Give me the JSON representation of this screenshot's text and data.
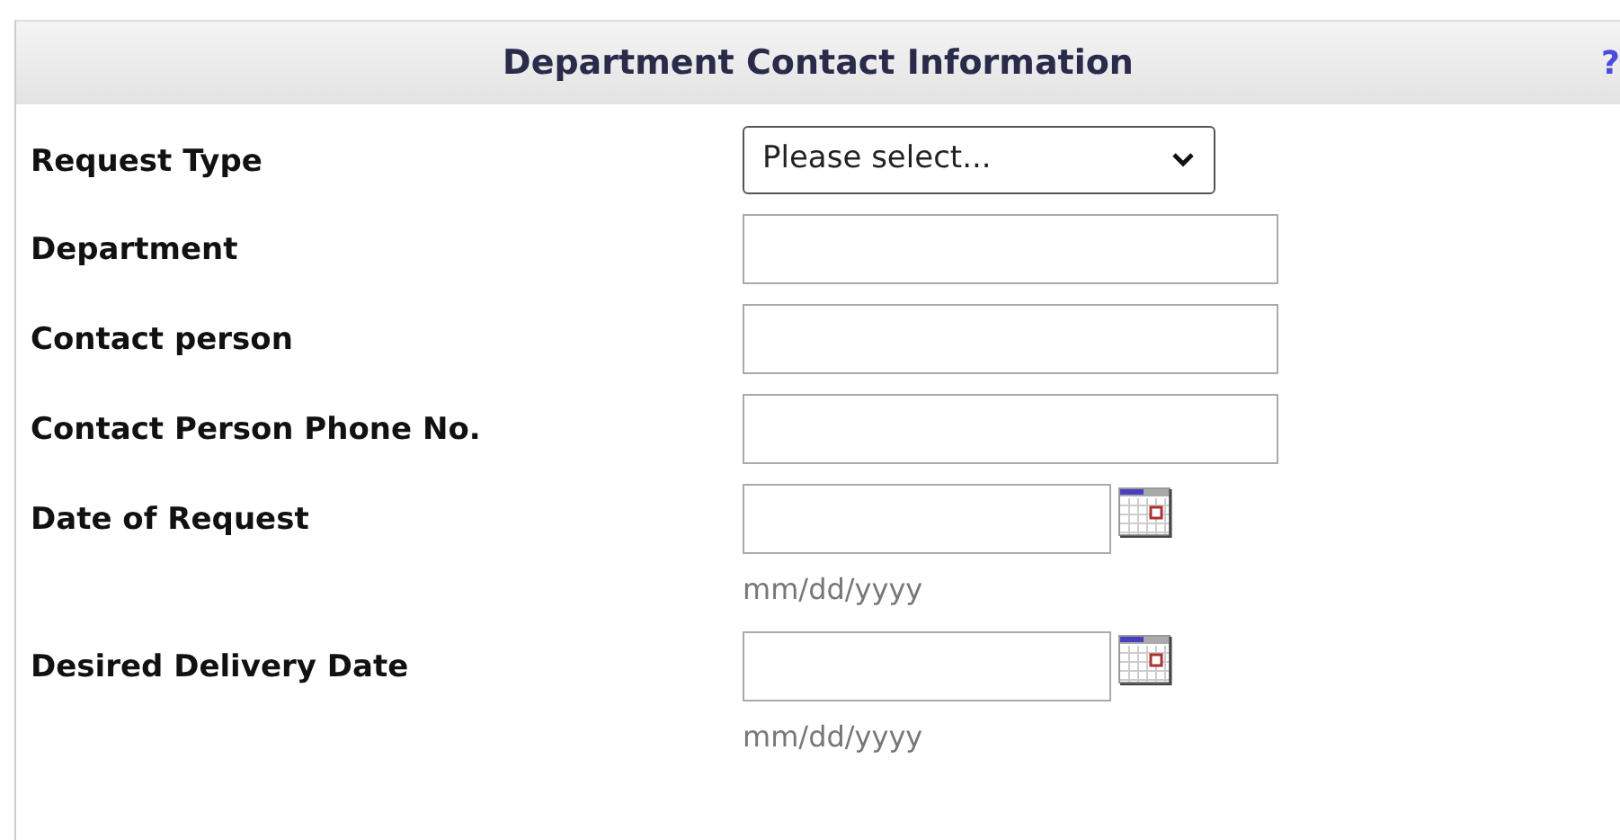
{
  "section": {
    "title": "Department Contact Information",
    "help": "?"
  },
  "fields": [
    {
      "kind": "select",
      "label": "Request Type",
      "value": "Please select..."
    },
    {
      "kind": "text",
      "label": "Department"
    },
    {
      "kind": "text",
      "label": "Contact person"
    },
    {
      "kind": "text",
      "label": "Contact Person Phone No."
    },
    {
      "kind": "date",
      "label": "Date of Request",
      "hint": "mm/dd/yyyy"
    },
    {
      "kind": "date",
      "label": "Desired Delivery Date",
      "hint": "mm/dd/yyyy"
    }
  ]
}
